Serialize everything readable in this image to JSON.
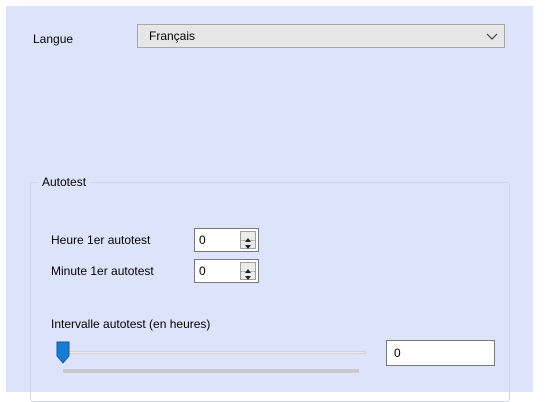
{
  "language": {
    "label": "Langue",
    "selected": "Français"
  },
  "autotest": {
    "group_title": "Autotest",
    "hour": {
      "label": "Heure 1er autotest",
      "value": "0"
    },
    "minute": {
      "label": "Minute 1er autotest",
      "value": "0"
    },
    "interval": {
      "label": "Intervalle autotest (en heures)",
      "value": "0",
      "slider_level": 0
    }
  },
  "icons": {
    "dropdown": "chevron-down-icon",
    "spin_up": "arrow-up-icon",
    "spin_down": "arrow-down-icon",
    "slider_thumb": "slider-thumb-icon"
  },
  "colors": {
    "panel_background": "#dde3fa",
    "slider_thumb": "#1a7bd6"
  }
}
